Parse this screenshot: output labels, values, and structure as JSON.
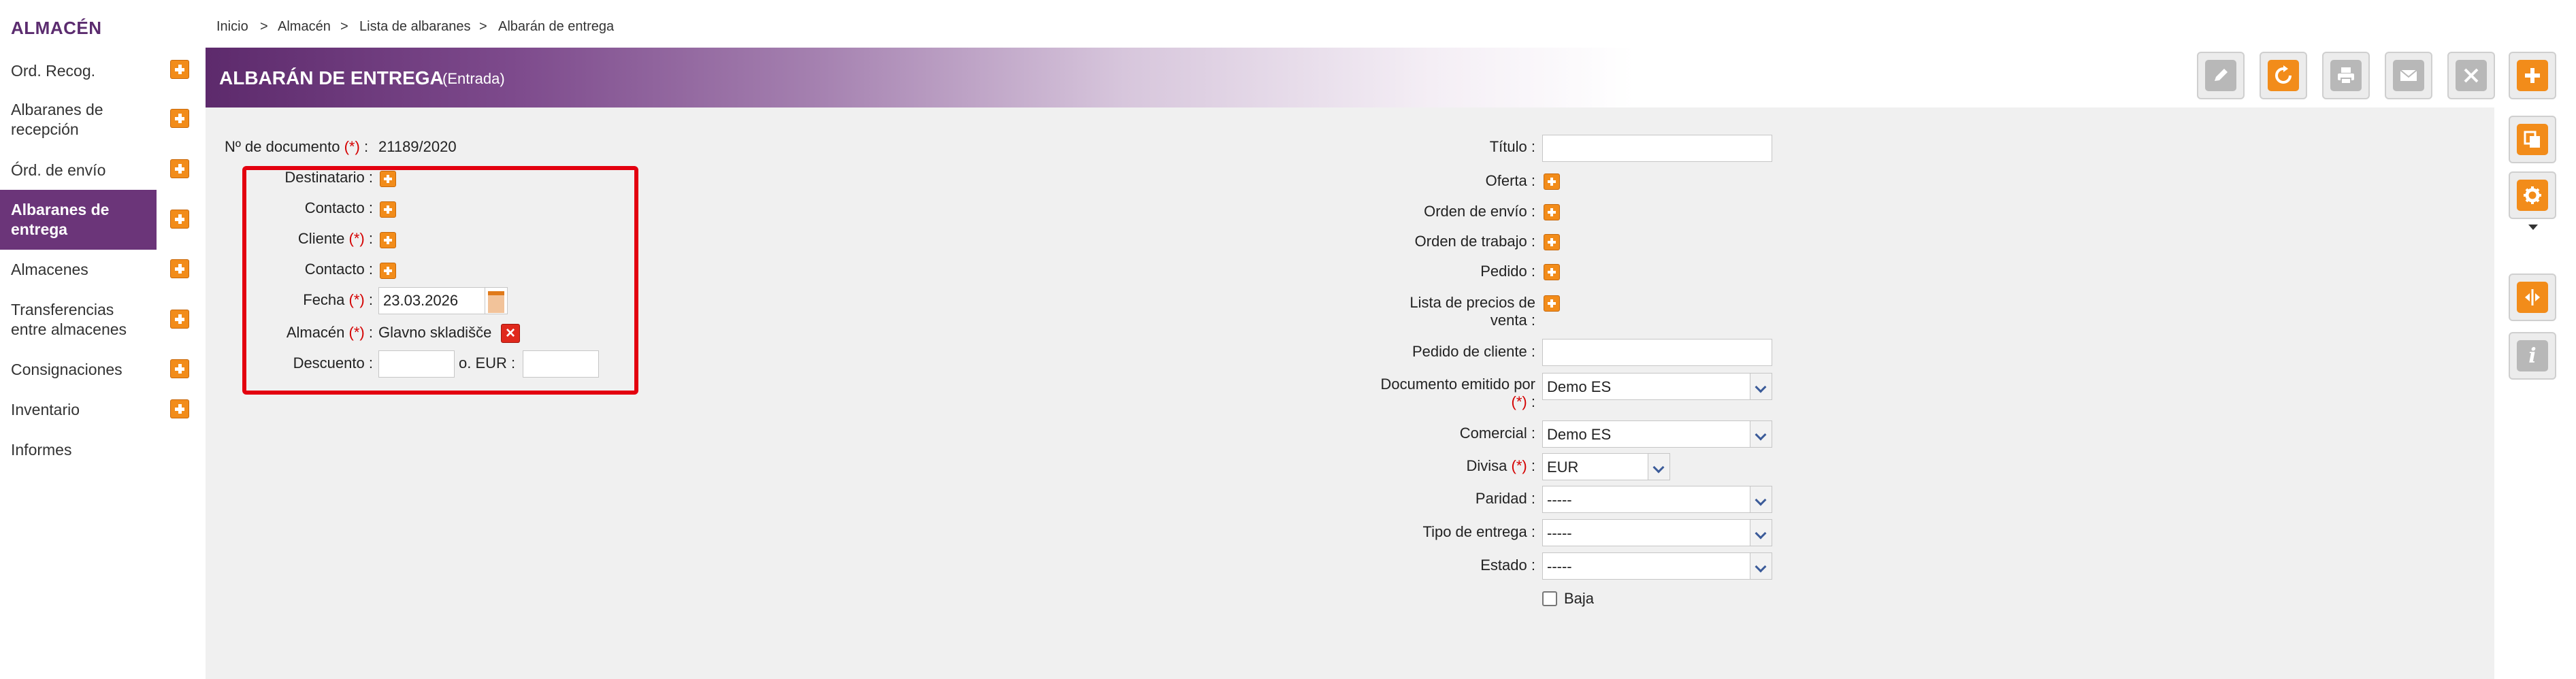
{
  "sidebar": {
    "title": "ALMACÉN",
    "items": [
      {
        "label": "Ord. Recog.",
        "has_add": true
      },
      {
        "label": "Albaranes de recepción",
        "has_add": true
      },
      {
        "label": "Órd. de envío",
        "has_add": true
      },
      {
        "label": "Albaranes de entrega",
        "has_add": true,
        "active": true
      },
      {
        "label": "Almacenes",
        "has_add": true
      },
      {
        "label": "Transferencias entre almacenes",
        "has_add": true
      },
      {
        "label": "Consignaciones",
        "has_add": true
      },
      {
        "label": "Inventario",
        "has_add": true
      },
      {
        "label": "Informes",
        "has_add": false
      }
    ]
  },
  "breadcrumb": {
    "items": [
      "Inicio",
      "Almacén",
      "Lista de albaranes",
      "Albarán de entrega"
    ],
    "separator": ">"
  },
  "header": {
    "title": "ALBARÁN DE ENTREGA",
    "subtitle": "(Entrada)"
  },
  "toolbar": {
    "buttons": [
      "edit-icon",
      "refresh-icon",
      "print-icon",
      "mail-icon",
      "close-icon",
      "add-icon"
    ],
    "side_buttons": [
      "copy-icon",
      "gear-icon",
      "split-icon",
      "info-icon"
    ]
  },
  "left_form": {
    "doc_number_label": "Nº de documento",
    "doc_number_value": "21189/2020",
    "destinatario_label": "Destinatario",
    "contacto_label": "Contacto",
    "cliente_label": "Cliente",
    "contacto2_label": "Contacto",
    "fecha_label": "Fecha",
    "fecha_value": "23.03.2026",
    "almacen_label": "Almacén",
    "almacen_value": "Glavno skladišče",
    "descuento_label": "Descuento",
    "descuento_value": "",
    "o_eur_label": "o. EUR",
    "o_eur_value": "",
    "required_mark": "(*)",
    "colon": ":"
  },
  "right_form": {
    "titulo_label": "Título",
    "titulo_value": "",
    "oferta_label": "Oferta",
    "orden_envio_label": "Orden de envío",
    "orden_trabajo_label": "Orden de trabajo",
    "pedido_label": "Pedido",
    "lista_precios_label_1": "Lista de precios de",
    "lista_precios_label_2": "venta",
    "pedido_cliente_label": "Pedido de cliente",
    "pedido_cliente_value": "",
    "doc_emitido_label_1": "Documento emitido por",
    "doc_emitido_value": "Demo ES",
    "comercial_label": "Comercial",
    "comercial_value": "Demo ES",
    "divisa_label": "Divisa",
    "divisa_value": "EUR",
    "paridad_label": "Paridad",
    "paridad_value": "-----",
    "tipo_entrega_label": "Tipo de entrega",
    "tipo_entrega_value": "-----",
    "estado_label": "Estado",
    "estado_value": "-----",
    "baja_label": "Baja",
    "baja_checked": false
  },
  "colors": {
    "brand": "#5d2a6c",
    "accent": "#f28c1a",
    "required": "#d40000",
    "highlight": "#e3000f"
  }
}
